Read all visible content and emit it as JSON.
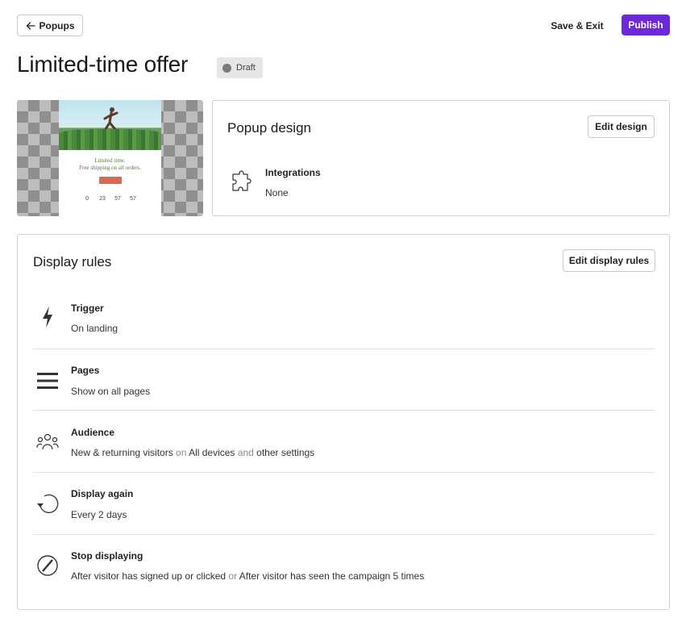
{
  "header": {
    "back_label": "Popups",
    "save_exit_label": "Save & Exit",
    "publish_label": "Publish",
    "publish_color": "#6d28d9"
  },
  "page": {
    "title": "Limited-time offer",
    "status": "Draft"
  },
  "preview": {
    "line1": "Limited time.",
    "line2": "Free shipping on all orders.",
    "timer": [
      "0",
      "23",
      "57",
      "57"
    ]
  },
  "design": {
    "title": "Popup design",
    "edit_label": "Edit design",
    "integrations_label": "Integrations",
    "integrations_value": "None",
    "integrations_icon": "puzzle-icon"
  },
  "rules": {
    "title": "Display rules",
    "edit_label": "Edit display rules",
    "items": [
      {
        "icon": "lightning-icon",
        "label": "Trigger",
        "value": "On landing"
      },
      {
        "icon": "list-icon",
        "label": "Pages",
        "value": "Show on all pages"
      },
      {
        "icon": "users-icon",
        "label": "Audience",
        "value_parts": [
          "New & returning visitors",
          " on ",
          "All devices",
          " and ",
          "other settings"
        ]
      },
      {
        "icon": "refresh-icon",
        "label": "Display again",
        "value": "Every 2 days"
      },
      {
        "icon": "prohibited-icon",
        "label": "Stop displaying",
        "value_parts": [
          "After visitor has signed up or clicked",
          " or ",
          "After visitor has seen the campaign 5 times"
        ]
      }
    ]
  }
}
